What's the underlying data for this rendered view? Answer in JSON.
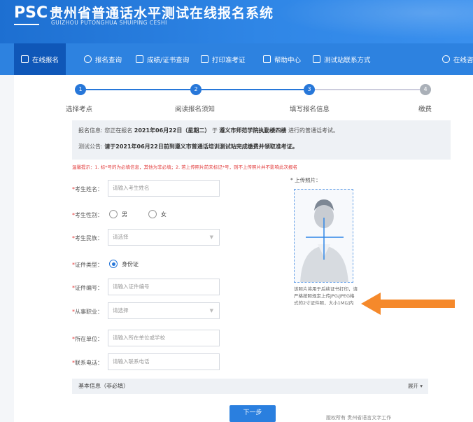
{
  "header": {
    "logo": "PSC",
    "title": "贵州省普通话水平测试在线报名系统",
    "subtitle": "GUIZHOU PUTONGHUA SHUIPING CESHI"
  },
  "nav": {
    "items": [
      {
        "label": "在线报名",
        "icon": "edit-icon",
        "active": true
      },
      {
        "label": "报名查询",
        "icon": "search-icon"
      },
      {
        "label": "成绩/证书查询",
        "icon": "certificate-search-icon"
      },
      {
        "label": "打印准考证",
        "icon": "printer-icon"
      },
      {
        "label": "帮助中心",
        "icon": "help-icon"
      },
      {
        "label": "测试站联系方式",
        "icon": "contact-icon"
      },
      {
        "label": "在线咨",
        "icon": "chat-icon"
      }
    ]
  },
  "steps": [
    {
      "num": "1",
      "label": "选择考点",
      "state": "done"
    },
    {
      "num": "2",
      "label": "阅读报名须知",
      "state": "done"
    },
    {
      "num": "3",
      "label": "填写报名信息",
      "state": "current"
    },
    {
      "num": "4",
      "label": "缴费",
      "state": "todo"
    }
  ],
  "info": {
    "line1_prefix": "报名信息: 您正在报名",
    "line1_date": "2021年06月22日（星期二）",
    "line1_mid": "于",
    "line1_place": "遵义市师范学院执勤楼四楼",
    "line1_suffix": "进行的普通话考试。",
    "line2_prefix": "测试公告:",
    "line2_text": "请于2021年06月22日前到遵义市普通话培训测试站完成缴费并领取准考证。"
  },
  "warning": "温馨提示：1. 标*号的为必填信息，其他为非必填；2. 若上传照片前未标记*号，则不上传照片并不影响此次报名",
  "form": {
    "name": {
      "label": "考生姓名：",
      "placeholder": "请输入考生姓名"
    },
    "gender": {
      "label": "考生性别：",
      "options": [
        "男",
        "女"
      ]
    },
    "ethnicity": {
      "label": "考生民族：",
      "placeholder": "请选择"
    },
    "id_type": {
      "label": "证件类型：",
      "value": "身份证"
    },
    "id_number": {
      "label": "证件编号：",
      "placeholder": "请输入证件编号"
    },
    "occupation": {
      "label": "从事职业：",
      "placeholder": "请选择"
    },
    "unit": {
      "label": "所在单位：",
      "placeholder": "请输入所在单位或学校"
    },
    "phone": {
      "label": "联系电话：",
      "placeholder": "请输入联系电话"
    }
  },
  "photo": {
    "label": "* 上传照片：",
    "note": "该照片将用于后续证书打印，请严格按照规定上传JPG/JPEG格式的2寸证件照，大小1M以内"
  },
  "basic": {
    "title": "基本信息（非必填）",
    "expand": "展开"
  },
  "next_button": "下一步",
  "footer_text": "版权所有 贵州省语言文字工作"
}
